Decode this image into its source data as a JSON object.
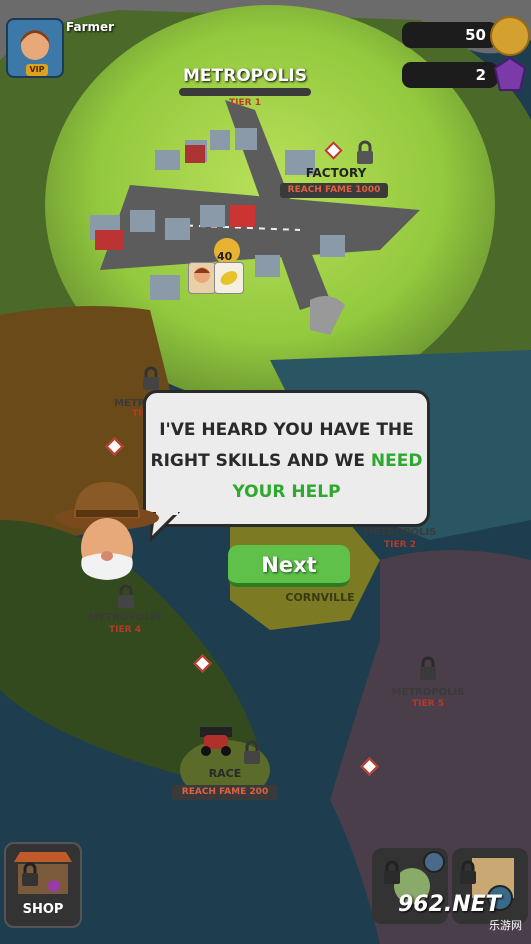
{
  "player": {
    "name": "Farmer",
    "badge": "VIP"
  },
  "currency": {
    "coins": "50",
    "gems": "2"
  },
  "map": {
    "metropolis_main": {
      "name": "METROPOLIS",
      "tier": "TIER 1"
    },
    "factory": {
      "name": "FACTORY",
      "requirement": "REACH FAME 1000"
    },
    "house_level": "40",
    "left_city_partial": {
      "name": "METRO",
      "tier": "TIE"
    },
    "metropolis_tier2": {
      "name": "METROPOLIS",
      "tier": "TIER 2"
    },
    "cornville": {
      "name": "CORNVILLE"
    },
    "metropolis_tier4": {
      "name": "METROPOLIS",
      "tier": "TIER 4"
    },
    "metropolis_tier5": {
      "name": "METROPOLIS",
      "tier": "TIER 5"
    },
    "race": {
      "name": "RACE",
      "requirement": "REACH FAME 200"
    }
  },
  "dialog": {
    "line1": "I'VE HEARD YOU HAVE THE",
    "line2_plain": "RIGHT SKILLS AND WE ",
    "line2_highlight": "NEED",
    "line3_highlight": "YOUR HELP",
    "highlight_color": "#2ea82e",
    "next_label": "Next"
  },
  "bottom": {
    "shop_label": "SHOP"
  },
  "watermark": {
    "brand": "962.NET",
    "sub": "乐游网"
  },
  "icons": [
    "avatar-icon",
    "coin-icon",
    "gem-icon",
    "lock-icon",
    "shop-stall-icon",
    "potion-icon",
    "compass-map-icon",
    "race-car-icon",
    "lemon-icon"
  ]
}
